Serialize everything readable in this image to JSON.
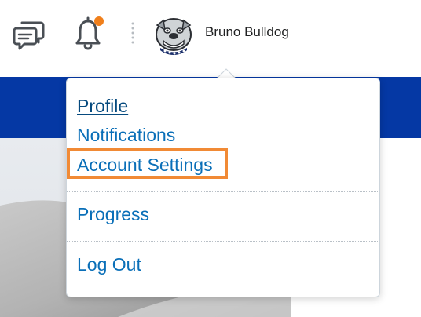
{
  "header": {
    "chat_icon": "chat-bubbles-icon",
    "bell_icon": "bell-icon",
    "notification_dot_color": "#f07f1b",
    "separator_icon": "vertical-dots-icon",
    "user_name": "Bruno Bulldog"
  },
  "colors": {
    "brand_blue": "#0538a4",
    "link_blue": "#0a6fb8",
    "highlight_orange": "#f18a35",
    "content_grey": "#e6eaef"
  },
  "dropdown": {
    "items": [
      {
        "label": "Profile",
        "state": "hover-underlined"
      },
      {
        "label": "Notifications"
      },
      {
        "label": "Account Settings",
        "state": "highlighted"
      },
      {
        "label": "Progress"
      },
      {
        "label": "Log Out"
      }
    ]
  }
}
